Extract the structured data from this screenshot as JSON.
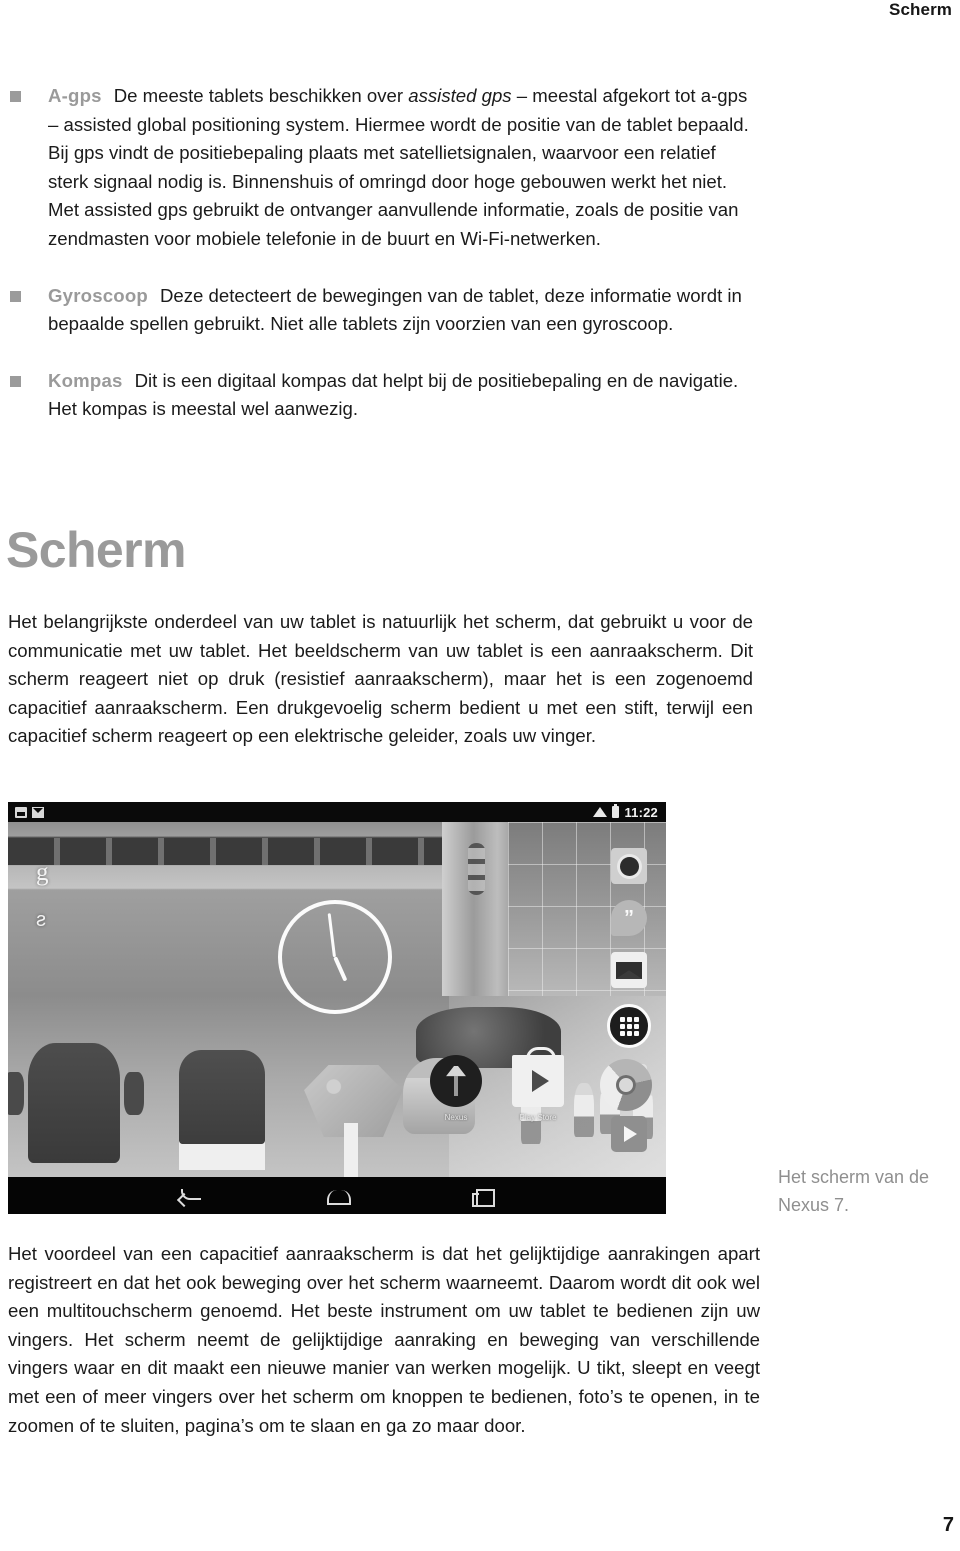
{
  "header": {
    "running_head": "Scherm"
  },
  "bullets": [
    {
      "term": "A-gps",
      "paragraphs": [
        {
          "segments": [
            {
              "text": "De meeste tablets beschikken over ",
              "style": "normal"
            },
            {
              "text": "assisted gps",
              "style": "italic"
            },
            {
              "text": " – meestal afgekort tot a-gps – assisted global positioning system. Hiermee wordt de positie van de tablet bepaald. Bij gps vindt de positiebepaling plaats met satellietsignalen, waarvoor een relatief sterk signaal nodig is. Binnenshuis of omringd door hoge gebouwen werkt het niet. Met assisted gps gebruikt de ontvanger aanvullende informatie, zoals de positie van zendmasten voor mobiele telefonie in de buurt en Wi-Fi-netwerken.",
              "style": "normal"
            }
          ]
        }
      ]
    },
    {
      "term": "Gyroscoop",
      "paragraphs": [
        {
          "segments": [
            {
              "text": "Deze detecteert de bewegingen van de tablet, deze informatie wordt in bepaalde spellen gebruikt. Niet alle tablets zijn voorzien van een gyroscoop.",
              "style": "normal"
            }
          ]
        }
      ]
    },
    {
      "term": "Kompas",
      "paragraphs": [
        {
          "segments": [
            {
              "text": "Dit is een digitaal kompas dat helpt bij de positiebepaling en de navigatie. Het kompas is meestal wel aanwezig.",
              "style": "normal"
            }
          ]
        }
      ]
    }
  ],
  "section": {
    "title": "Scherm",
    "intro_paragraph": "Het belangrijkste onderdeel van uw tablet is natuurlijk het scherm, dat gebruikt u voor de communicatie met uw tablet. Het beeldscherm van uw tablet is een aanraakscherm. Dit scherm reageert niet op druk (resistief aanraakscherm), maar het is een zogenoemd capacitief aanraakscherm. Een drukgevoelig scherm bedient u met een stift, terwijl een capacitief scherm reageert op een elektrische geleider, zoals uw vinger.",
    "outro_paragraph": "Het voordeel van een capacitief aanraakscherm is dat het gelijktijdige aanrakingen apart registreert en dat het ook beweging over het scherm waarneemt. Daarom wordt dit ook wel een multitouchscherm genoemd. Het beste instrument om uw tablet te bedienen zijn uw vingers. Het scherm neemt de gelijktijdige aanraking en beweging van verschillende vingers waar en dit maakt een nieuwe manier van werken mogelijk. U tikt, sleept en veegt met een of meer vingers over het scherm om knoppen te bedienen, foto’s te openen, in te zoomen of te sluiten, pagina’s om te slaan en ga zo maar door."
  },
  "figure": {
    "caption": "Het scherm van de Nexus 7.",
    "tablet": {
      "status_bar": {
        "left_icons": [
          "screenshot-icon",
          "mail-icon"
        ],
        "wifi_icon": "wifi-icon",
        "battery_icon": "battery-icon",
        "clock": "11:22"
      },
      "search_widget": {
        "google_glyph": "g",
        "mic_glyph": "ƨ"
      },
      "side_icons": [
        {
          "name": "camera-app-icon",
          "label": "Camera"
        },
        {
          "name": "hangouts-app-icon",
          "label": "”"
        },
        {
          "name": "gmail-app-icon",
          "label": "Gmail"
        },
        {
          "name": "app-drawer-icon",
          "label": "Apps"
        },
        {
          "name": "maps-app-icon",
          "label": "Maps"
        },
        {
          "name": "play-app-icon",
          "label": "Play"
        }
      ],
      "dock_icons": [
        {
          "name": "nexus-app-icon",
          "label": "Nexus"
        },
        {
          "name": "play-store-app-icon",
          "label": "Play Store"
        },
        {
          "name": "chrome-app-icon",
          "label": ""
        }
      ],
      "nav_bar": [
        "back-icon",
        "home-icon",
        "recents-icon"
      ]
    }
  },
  "folio": {
    "page_number": "7"
  },
  "colors": {
    "accent_gray": "#9a9a9a",
    "text": "#1b1b1b",
    "caption": "#8f8f8f"
  }
}
